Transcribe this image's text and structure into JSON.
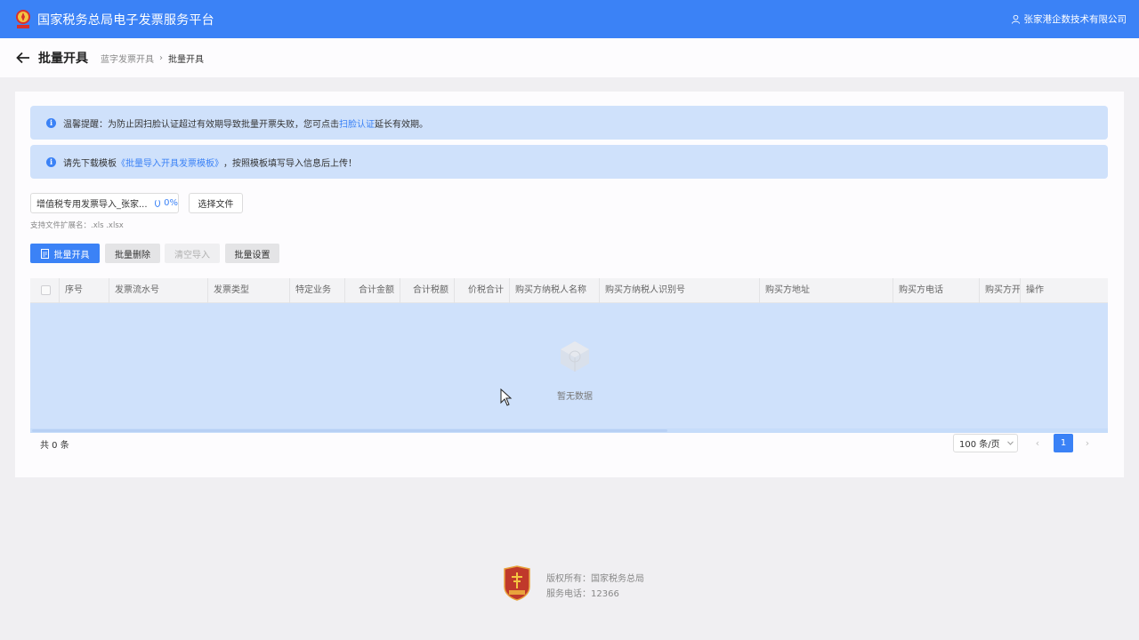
{
  "topbar": {
    "title": "国家税务总局电子发票服务平台",
    "user": "张家港企数技术有限公司",
    "background": "#3b82f6"
  },
  "subheader": {
    "title": "批量开具",
    "breadcrumb": [
      "蓝字发票开具",
      "批量开具"
    ],
    "separator": "›"
  },
  "alerts": {
    "first": {
      "prefix": "温馨提醒：为防止因扫脸认证超过有效期导致批量开票失败，您可点击",
      "link": "扫脸认证",
      "suffix": "延长有效期。"
    },
    "second": {
      "prefix": "请先下载模板",
      "link": "《批量导入开具发票模板》",
      "suffix": "，按照模板填写导入信息后上传！"
    }
  },
  "upload": {
    "file_name": "增值税专用发票导入_张家...",
    "progress": "0%",
    "choose_label": "选择文件",
    "hint": "支持文件扩展名：.xls .xlsx"
  },
  "toolbar": {
    "batch_issue": "批量开具",
    "batch_delete": "批量删除",
    "clear_import": "清空导入",
    "batch_settings": "批量设置"
  },
  "table": {
    "columns": [
      "序号",
      "发票流水号",
      "发票类型",
      "特定业务",
      "合计金额",
      "合计税额",
      "价税合计",
      "购买方纳税人名称",
      "购买方纳税人识别号",
      "购买方地址",
      "购买方电话",
      "购买方开",
      "操作"
    ],
    "rows": [],
    "empty_text": "暂无数据"
  },
  "pagination": {
    "total": "共 0 条",
    "page_size": "100 条/页",
    "prev": "‹",
    "current": "1",
    "next": "›"
  },
  "footer": {
    "copyright": "版权所有：国家税务总局",
    "phone": "服务电话：12366"
  },
  "colors": {
    "primary": "#3b82f6",
    "alert_bg": "#cfe1fb",
    "page_bg": "#f0eff2"
  }
}
